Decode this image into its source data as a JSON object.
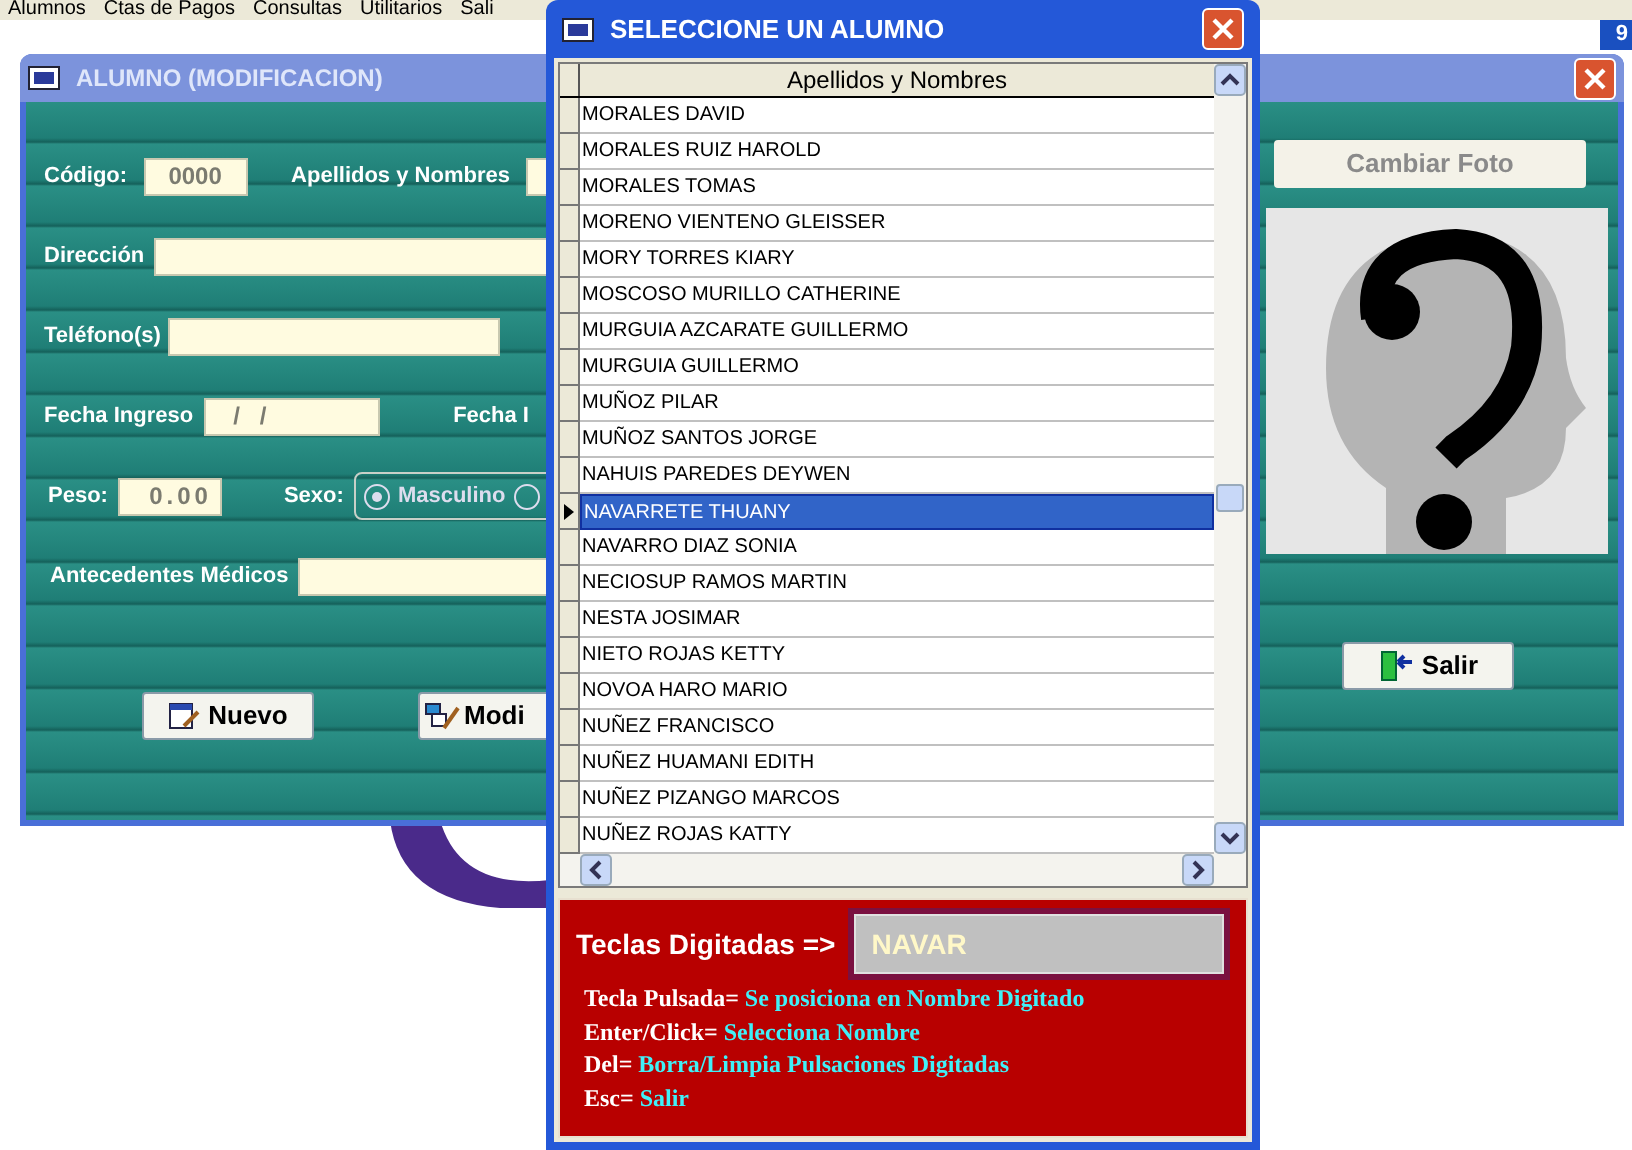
{
  "menu_bar": [
    "Alumnos",
    "Ctas de Pagos",
    "Consultas",
    "Utilitarios",
    "Sali"
  ],
  "corner_badge": "9",
  "alumno_window": {
    "title": "ALUMNO (MODIFICACION)",
    "codigo": {
      "label": "Código:",
      "value": "0000"
    },
    "apellidos": {
      "label": "Apellidos y Nombres"
    },
    "direccion": {
      "label": "Dirección"
    },
    "telefono": {
      "label": "Teléfono(s)"
    },
    "fecha_ingreso": {
      "label": "Fecha Ingreso",
      "value": "/   /"
    },
    "fecha_label": "Fecha I",
    "peso": {
      "label": "Peso:",
      "value": "0.00"
    },
    "sexo": {
      "label": "Sexo:",
      "options": [
        {
          "label": "Masculino",
          "selected": true
        },
        {
          "selected": false
        }
      ]
    },
    "antecedentes": {
      "label": "Antecedentes Médicos"
    },
    "photo_button": "Cambiar Foto",
    "buttons": [
      {
        "label": "Nuevo",
        "kind": "new"
      },
      {
        "label": "Modi",
        "kind": "edit"
      },
      {
        "label": "Salir",
        "kind": "exit"
      }
    ]
  },
  "dialog": {
    "title": "SELECCIONE UN ALUMNO",
    "column": "Apellidos y Nombres",
    "rows": [
      {
        "name": "MORALES DAVID",
        "selected": false
      },
      {
        "name": "MORALES RUIZ HAROLD",
        "selected": false
      },
      {
        "name": "MORALES TOMAS",
        "selected": false
      },
      {
        "name": "MORENO VIENTENO GLEISSER",
        "selected": false
      },
      {
        "name": "MORY TORRES KIARY",
        "selected": false
      },
      {
        "name": "MOSCOSO MURILLO CATHERINE",
        "selected": false
      },
      {
        "name": "MURGUIA AZCARATE GUILLERMO",
        "selected": false
      },
      {
        "name": "MURGUIA GUILLERMO",
        "selected": false
      },
      {
        "name": "MUÑOZ PILAR",
        "selected": false
      },
      {
        "name": "MUÑOZ SANTOS JORGE",
        "selected": false
      },
      {
        "name": "NAHUIS PAREDES DEYWEN",
        "selected": false
      },
      {
        "name": "NAVARRETE THUANY",
        "selected": true
      },
      {
        "name": "NAVARRO DIAZ SONIA",
        "selected": false
      },
      {
        "name": "NECIOSUP RAMOS MARTIN",
        "selected": false
      },
      {
        "name": "NESTA JOSIMAR",
        "selected": false
      },
      {
        "name": "NIETO ROJAS KETTY",
        "selected": false
      },
      {
        "name": "NOVOA HARO MARIO",
        "selected": false
      },
      {
        "name": "NUÑEZ FRANCISCO",
        "selected": false
      },
      {
        "name": "NUÑEZ HUAMANI EDITH",
        "selected": false
      },
      {
        "name": "NUÑEZ PIZANGO MARCOS",
        "selected": false
      },
      {
        "name": "NUÑEZ ROJAS KATTY",
        "selected": false
      }
    ],
    "keys_label": "Teclas Digitadas =>",
    "keys_value": "NAVAR",
    "help": [
      {
        "key": "Tecla Pulsada=",
        "action": "Se posiciona en Nombre Digitado"
      },
      {
        "key": "Enter/Click=",
        "action": "Selecciona Nombre"
      },
      {
        "key": "Del=",
        "action": "Borra/Limpia Pulsaciones Digitadas"
      },
      {
        "key": "Esc=",
        "action": "Salir"
      }
    ]
  }
}
